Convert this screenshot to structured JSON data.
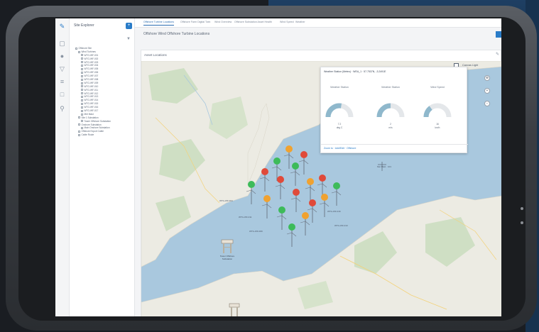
{
  "colors": {
    "accent": "#2a7cc8",
    "turbine_red": "#e04a3a",
    "turbine_green": "#3dbb5a",
    "turbine_amber": "#f0a230",
    "water": "#a9c8de",
    "land": "#ecebe3",
    "forest": "#cfdfc4"
  },
  "icons": [
    "sitemap-icon",
    "chart-icon",
    "user-icon",
    "bell-icon",
    "list-icon",
    "clipboard-icon",
    "wrench-icon"
  ],
  "explorer": {
    "title": "Site Explorer",
    "tree": [
      {
        "level": 0,
        "label": "Offshore Site"
      },
      {
        "level": 1,
        "label": "Wind Turbines"
      },
      {
        "level": 2,
        "label": "WTG-WF-001"
      },
      {
        "level": 2,
        "label": "WTG-WF-002"
      },
      {
        "level": 2,
        "label": "WTG-WF-003"
      },
      {
        "level": 2,
        "label": "WTG-WF-004"
      },
      {
        "level": 2,
        "label": "WTG-WF-005"
      },
      {
        "level": 2,
        "label": "WTG-WF-006"
      },
      {
        "level": 2,
        "label": "WTG-WF-007"
      },
      {
        "level": 2,
        "label": "WTG-WF-008"
      },
      {
        "level": 2,
        "label": "WTG-WF-009"
      },
      {
        "level": 2,
        "label": "WTG-WF-010"
      },
      {
        "level": 2,
        "label": "WTG-WF-011"
      },
      {
        "level": 2,
        "label": "WTG-WF-012"
      },
      {
        "level": 2,
        "label": "WTG-WF-013"
      },
      {
        "level": 2,
        "label": "WTG-WF-014"
      },
      {
        "level": 2,
        "label": "WTG-WF-015"
      },
      {
        "level": 2,
        "label": "WTG-WF-016"
      },
      {
        "level": 2,
        "label": "WTG-WF-017"
      },
      {
        "level": 2,
        "label": "Met Mast"
      },
      {
        "level": 1,
        "label": "Site 1 Substation"
      },
      {
        "level": 2,
        "label": "Tower Offshore Substation"
      },
      {
        "level": 1,
        "label": "Onshore Substation"
      },
      {
        "level": 2,
        "label": "Main Onshore Substation"
      },
      {
        "level": 1,
        "label": "Offshore Export Cable"
      },
      {
        "level": 1,
        "label": "Cable Route"
      }
    ]
  },
  "tabs": [
    "Offshore Turbine Locations",
    "Offshore Farm Digital Twin",
    "Wind Overview",
    "Offshore Substation Asset Health",
    "Wind Speed",
    "Weather"
  ],
  "page_title": "Offshore Wind Offshore Turbine Locations",
  "panel_title": "Asset Locations",
  "map": {
    "style_label": "Canvas Light",
    "popup": {
      "title": "Weather Station (Meteo) · WEA_1 · 57.7537N, -3.2491E",
      "gauges": [
        {
          "label": "Weather Station",
          "value": "7.2",
          "unit": "deg C",
          "fill": 0.55
        },
        {
          "label": "Weather Station",
          "value": "2",
          "unit": "m/s",
          "fill": 0.5
        },
        {
          "label": "Wind Speed",
          "value": "16",
          "unit": "km/h",
          "fill": 0.3
        }
      ],
      "footer": "Zoom to · Add/Edit · Offshore"
    },
    "turbines": [
      {
        "status": "amber"
      },
      {
        "status": "green"
      },
      {
        "status": "red"
      },
      {
        "status": "green"
      },
      {
        "status": "red"
      },
      {
        "status": "green"
      },
      {
        "status": "red"
      },
      {
        "status": "amber"
      },
      {
        "status": "red"
      },
      {
        "status": "amber"
      },
      {
        "status": "red"
      },
      {
        "status": "green"
      },
      {
        "status": "amber"
      },
      {
        "status": "green"
      },
      {
        "status": "red"
      },
      {
        "status": "green"
      },
      {
        "status": "amber"
      }
    ],
    "labels": [
      "WTG-WF-004",
      "WTG-WF-011",
      "WTG-WF-009",
      "WTG-WF-016",
      "WTG-WF-013",
      "Met Mast · 101"
    ],
    "substation_label": "Tower Offshore Substation"
  }
}
